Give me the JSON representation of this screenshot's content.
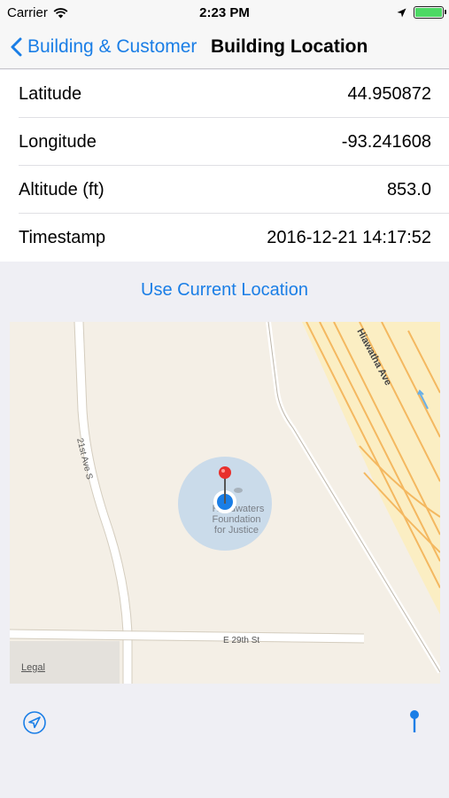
{
  "status_bar": {
    "carrier": "Carrier",
    "time": "2:23 PM",
    "battery_level": 1.0,
    "battery_color": "#4cd964"
  },
  "nav": {
    "back_label": "Building & Customer",
    "title": "Building Location",
    "accent": "#1a7ee6"
  },
  "location": {
    "rows": [
      {
        "label": "Latitude",
        "value": "44.950872"
      },
      {
        "label": "Longitude",
        "value": "-93.241608"
      },
      {
        "label": "Altitude (ft)",
        "value": "853.0"
      },
      {
        "label": "Timestamp",
        "value": "2016-12-21 14:17:52"
      }
    ]
  },
  "use_current_label": "Use Current Location",
  "map": {
    "streets": {
      "avenue": "21st Ave S",
      "street": "E 29th St",
      "highway": "Hiawatha Ave"
    },
    "poi": [
      "Headwaters",
      "Foundation",
      "for Justice"
    ],
    "legal": "Legal",
    "pin_color": "#e8302c",
    "user_dot_color": "#1a7ee6"
  },
  "toolbar": {
    "locate_icon": "location-arrow-icon",
    "pin_icon": "map-pin-icon"
  }
}
